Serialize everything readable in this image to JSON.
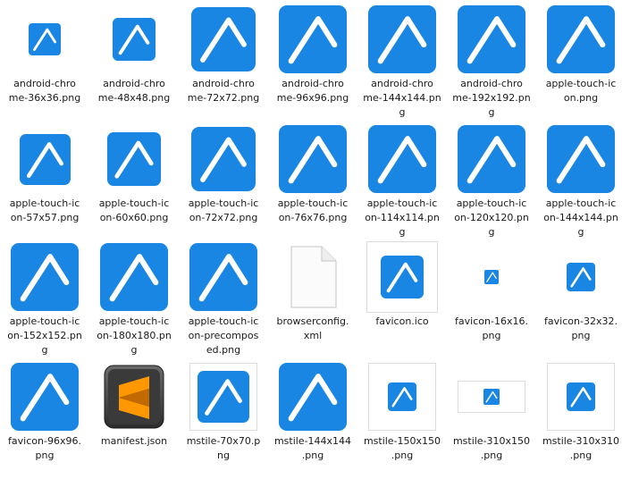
{
  "files": [
    {
      "name": "android-chro\nme-36x36.png",
      "icon": "app-icon",
      "kind": "blue",
      "size": 36
    },
    {
      "name": "android-chro\nme-48x48.png",
      "icon": "app-icon",
      "kind": "blue",
      "size": 48
    },
    {
      "name": "android-chro\nme-72x72.png",
      "icon": "app-icon",
      "kind": "blue",
      "size": 72
    },
    {
      "name": "android-chro\nme-96x96.png",
      "icon": "app-icon",
      "kind": "blue",
      "size": 76
    },
    {
      "name": "android-chro\nme-144x144.pn\ng",
      "icon": "app-icon",
      "kind": "blue",
      "size": 76
    },
    {
      "name": "android-chro\nme-192x192.pn\ng",
      "icon": "app-icon",
      "kind": "blue",
      "size": 76
    },
    {
      "name": "apple-touch-ic\non.png",
      "icon": "app-icon",
      "kind": "blue",
      "size": 76
    },
    {
      "name": "apple-touch-ic\non-57x57.png",
      "icon": "app-icon",
      "kind": "blue",
      "size": 57
    },
    {
      "name": "apple-touch-ic\non-60x60.png",
      "icon": "app-icon",
      "kind": "blue",
      "size": 60
    },
    {
      "name": "apple-touch-ic\non-72x72.png",
      "icon": "app-icon",
      "kind": "blue",
      "size": 72
    },
    {
      "name": "apple-touch-ic\non-76x76.png",
      "icon": "app-icon",
      "kind": "blue",
      "size": 76
    },
    {
      "name": "apple-touch-ic\non-114x114.pn\ng",
      "icon": "app-icon",
      "kind": "blue",
      "size": 76
    },
    {
      "name": "apple-touch-ic\non-120x120.pn\ng",
      "icon": "app-icon",
      "kind": "blue",
      "size": 76
    },
    {
      "name": "apple-touch-ic\non-144x144.pn\ng",
      "icon": "app-icon",
      "kind": "blue",
      "size": 76
    },
    {
      "name": "apple-touch-ic\non-152x152.pn\ng",
      "icon": "app-icon",
      "kind": "blue",
      "size": 76
    },
    {
      "name": "apple-touch-ic\non-180x180.pn\ng",
      "icon": "app-icon",
      "kind": "blue",
      "size": 76
    },
    {
      "name": "apple-touch-ic\non-precompos\ned.png",
      "icon": "app-icon",
      "kind": "blue",
      "size": 76
    },
    {
      "name": "browserconfig.\nxml",
      "icon": "blank-document-icon",
      "kind": "doc",
      "size": 0
    },
    {
      "name": "favicon.ico",
      "icon": "favicon-icon",
      "kind": "tile",
      "size": 48,
      "frame": [
        80,
        80
      ]
    },
    {
      "name": "favicon-16x16.\npng",
      "icon": "app-icon",
      "kind": "blue",
      "size": 16
    },
    {
      "name": "favicon-32x32.\npng",
      "icon": "app-icon",
      "kind": "blue",
      "size": 32
    },
    {
      "name": "favicon-96x96.\npng",
      "icon": "app-icon",
      "kind": "blue",
      "size": 76
    },
    {
      "name": "manifest.json",
      "icon": "sublime-text-icon",
      "kind": "sublime",
      "size": 0
    },
    {
      "name": "mstile-70x70.p\nng",
      "icon": "ms-tile-icon",
      "kind": "tile",
      "size": 58,
      "frame": [
        76,
        76
      ]
    },
    {
      "name": "mstile-144x144\n.png",
      "icon": "app-icon",
      "kind": "blue",
      "size": 76
    },
    {
      "name": "mstile-150x150\n.png",
      "icon": "ms-tile-icon",
      "kind": "tile",
      "size": 32,
      "frame": [
        76,
        76
      ]
    },
    {
      "name": "mstile-310x150\n.png",
      "icon": "ms-tile-icon",
      "kind": "tile",
      "size": 18,
      "frame": [
        76,
        36
      ]
    },
    {
      "name": "mstile-310x310\n.png",
      "icon": "ms-tile-icon",
      "kind": "tile",
      "size": 32,
      "frame": [
        76,
        76
      ]
    }
  ],
  "colors": {
    "brand_blue": "#1a86e3",
    "caret_white": "#ffffff"
  }
}
